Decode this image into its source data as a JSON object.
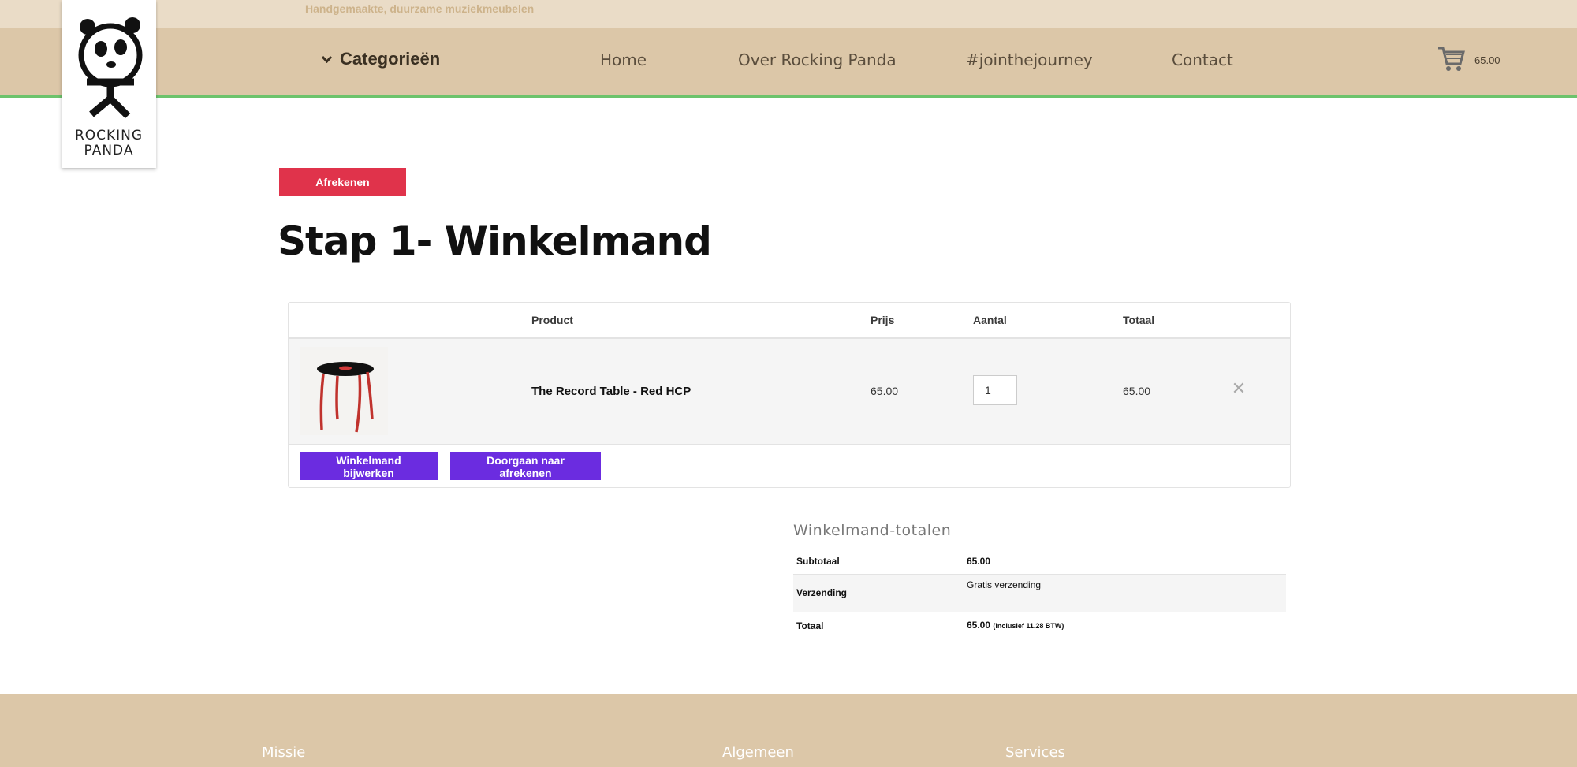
{
  "header": {
    "tagline": "Handgemaakte, duurzame muziekmeubelen",
    "logo_text_line1": "ROCKING",
    "logo_text_line2": "PANDA",
    "categories_label": "Categorieën",
    "nav": [
      "Home",
      "Over Rocking Panda",
      "#jointhejourney",
      "Contact"
    ],
    "cart_amount": "65.00"
  },
  "checkout_button": "Afrekenen",
  "page_title": "Stap 1- Winkelmand",
  "cart": {
    "headers": {
      "product": "Product",
      "price": "Prijs",
      "qty": "Aantal",
      "total": "Totaal"
    },
    "items": [
      {
        "name": "The Record Table - Red HCP",
        "price": "65.00",
        "qty": "1",
        "total": "65.00"
      }
    ],
    "update_button": "Winkelmand bijwerken",
    "proceed_button": "Doorgaan naar afrekenen"
  },
  "totals": {
    "title": "Winkelmand-totalen",
    "subtotal_label": "Subtotaal",
    "subtotal_value": "65.00",
    "shipping_label": "Verzending",
    "shipping_value": "Gratis verzending",
    "total_label": "Totaal",
    "total_value": "65.00",
    "total_note": "(inclusief 11.28 BTW)"
  },
  "footer": {
    "col1": "Missie",
    "col2": "Algemeen",
    "col3": "Services"
  },
  "colors": {
    "accent_red": "#e0334b",
    "accent_purple": "#6b2ce0",
    "nav_bg": "#dcc7a8",
    "nav_border": "#6cc36c"
  },
  "icons": [
    "panda-logo",
    "chevron-down-icon",
    "cart-icon",
    "remove-icon"
  ]
}
